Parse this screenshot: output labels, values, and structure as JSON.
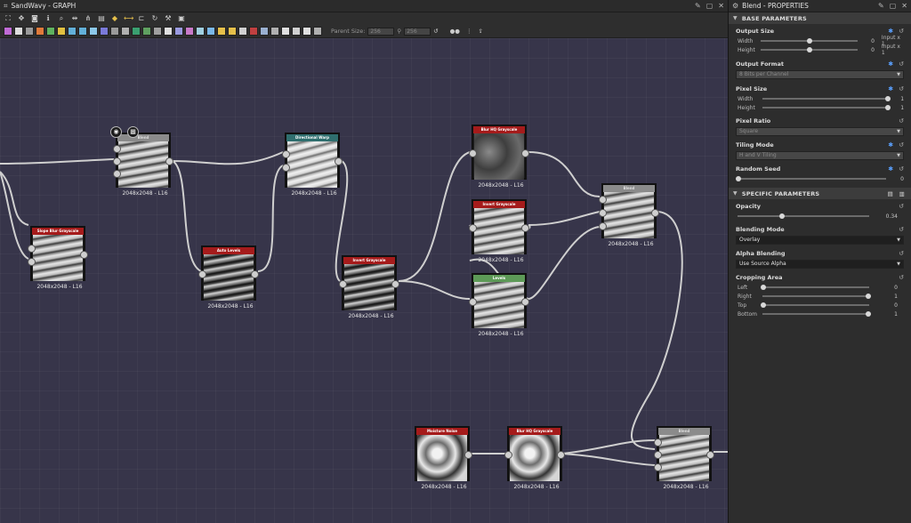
{
  "graph": {
    "title": "SandWavy - GRAPH",
    "parent_size_label": "Parent Size:",
    "parent_size_value": "256",
    "size_value": "256",
    "toolbar_icons": [
      "fit-icon",
      "pan-icon",
      "screenshot-icon",
      "info-icon",
      "search-icon",
      "align-icon",
      "share-icon",
      "layout-icon",
      "python-icon",
      "link-icon",
      "hierarchy-icon",
      "refresh-icon",
      "tools-icon",
      "frame-icon"
    ],
    "node_button_colors": [
      "#c06bd6",
      "#dedede",
      "#9a9a9a",
      "#e07a3a",
      "#5fb35f",
      "#e0c040",
      "#62b0d8",
      "#62b0d8",
      "#8cc8e8",
      "#7a7ad8",
      "#9a9a9a",
      "#b0b0b0",
      "#3aa070",
      "#5fa060",
      "#a0a0a0",
      "#e0e0e0",
      "#9a9ae0",
      "#c87ac8",
      "#a0d0e0",
      "#7ab8e8",
      "#e6c04a",
      "#e6c04a",
      "#d0d0d0",
      "#c04040",
      "#9ab0d0",
      "#b0b0b0",
      "#e0e0e0",
      "#d0d0d0",
      "#e0e0e0",
      "#b0b0b0"
    ],
    "nodes": [
      {
        "id": "blend1",
        "title": "Blend",
        "header": "grey",
        "thumb": "",
        "size_label": "2048x2048 - L16"
      },
      {
        "id": "slopeblur",
        "title": "Slope Blur Grayscale",
        "header": "red",
        "thumb": "",
        "size_label": "2048x2048 - L16"
      },
      {
        "id": "autolevels",
        "title": "Auto Levels",
        "header": "red",
        "thumb": "dark",
        "size_label": "2048x2048 - L16"
      },
      {
        "id": "dirwarp",
        "title": "Directional Warp",
        "header": "teal",
        "thumb": "wavy-light",
        "size_label": "2048x2048 - L16"
      },
      {
        "id": "invert1",
        "title": "Invert Grayscale",
        "header": "red",
        "thumb": "dark",
        "size_label": "2048x2048 - L16"
      },
      {
        "id": "blurhq1",
        "title": "Blur HQ Grayscale",
        "header": "red",
        "thumb": "blur",
        "size_label": "2048x2048 - L16"
      },
      {
        "id": "invert2",
        "title": "Invert Grayscale",
        "header": "red",
        "thumb": "",
        "size_label": "2048x2048 - L16"
      },
      {
        "id": "levels",
        "title": "Levels",
        "header": "green",
        "thumb": "",
        "size_label": "2048x2048 - L16"
      },
      {
        "id": "blend2",
        "title": "Blend",
        "header": "grey",
        "thumb": "",
        "size_label": "2048x2048 - L16"
      },
      {
        "id": "moisture",
        "title": "Moisture Noise",
        "header": "red",
        "thumb": "noise",
        "size_label": "2048x2048 - L16"
      },
      {
        "id": "blurhq2",
        "title": "Blur HQ Grayscale",
        "header": "red",
        "thumb": "noise",
        "size_label": "2048x2048 - L16"
      },
      {
        "id": "blend3",
        "title": "Blend",
        "header": "grey",
        "thumb": "",
        "size_label": "2048x2048 - L16"
      }
    ]
  },
  "properties": {
    "title": "Blend - PROPERTIES",
    "base_header": "BASE PARAMETERS",
    "specific_header": "SPECIFIC PARAMETERS",
    "output_size": {
      "title": "Output Size",
      "width_label": "Width",
      "width_val": "0",
      "width_extra": "Input x 1",
      "width_pos": 0.5,
      "height_label": "Height",
      "height_val": "0",
      "height_extra": "Input x 1",
      "height_pos": 0.5
    },
    "output_format": {
      "title": "Output Format",
      "value": "8 Bits per Channel"
    },
    "pixel_size": {
      "title": "Pixel Size",
      "width_label": "Width",
      "width_val": "1",
      "height_label": "Height",
      "height_val": "1"
    },
    "pixel_ratio": {
      "title": "Pixel Ratio",
      "value": "Square"
    },
    "tiling_mode": {
      "title": "Tiling Mode",
      "value": "H and V Tiling"
    },
    "random_seed": {
      "title": "Random Seed",
      "val": "0"
    },
    "opacity": {
      "title": "Opacity",
      "val": "0.34",
      "pos": 0.34
    },
    "blending_mode": {
      "title": "Blending Mode",
      "value": "Overlay"
    },
    "alpha_blending": {
      "title": "Alpha Blending",
      "value": "Use Source Alpha"
    },
    "cropping": {
      "title": "Cropping Area",
      "left_label": "Left",
      "left_val": "0",
      "right_label": "Right",
      "right_val": "1",
      "top_label": "Top",
      "top_val": "0",
      "bottom_label": "Bottom",
      "bottom_val": "1"
    }
  }
}
